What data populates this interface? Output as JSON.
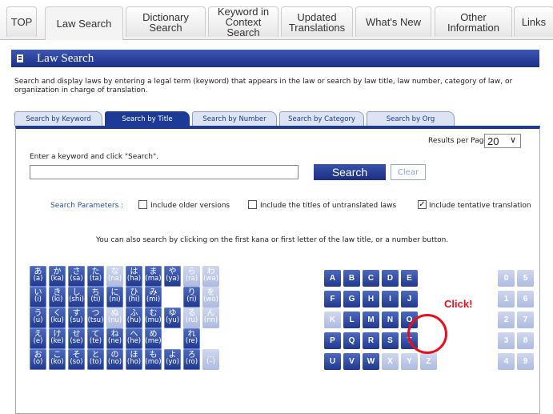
{
  "topnav": {
    "tabs": [
      "TOP",
      "Law Search",
      "Dictionary\nSearch",
      "Keyword in\nContext Search",
      "Updated\nTranslations",
      "What's New",
      "Other\nInformation",
      "Links"
    ]
  },
  "header": {
    "title": "Law Search"
  },
  "description": "Search and display laws by entering a legal term (keyword) that appears in the law or search by law title, law number, category of law, or organization in charge of translation.",
  "search_tabs": [
    "Search by Keyword",
    "Search by Title",
    "Search by Number",
    "Search by Category",
    "Search by Org"
  ],
  "results_per_page": {
    "label": "Results per Page :",
    "value": "20"
  },
  "keyword": {
    "instruction": "Enter a keyword and click \"Search\".",
    "value": "",
    "search_label": "Search",
    "clear_label": "Clear"
  },
  "params": {
    "label": "Search Parameters :",
    "older": "Include older versions",
    "untranslated": "Include the titles of untranslated laws",
    "tentative": "Include tentative translation",
    "tentative_checked": true
  },
  "hint": "You can also search by clicking on the first kana or first letter of the law title, or a number button.",
  "kana": [
    [
      [
        "あ",
        "(a)",
        1
      ],
      [
        "か",
        "(ka)",
        1
      ],
      [
        "さ",
        "(sa)",
        1
      ],
      [
        "た",
        "(ta)",
        1
      ],
      [
        "な",
        "(na)",
        0
      ],
      [
        "は",
        "(ha)",
        1
      ],
      [
        "ま",
        "(ma)",
        1
      ],
      [
        "や",
        "(ya)",
        1
      ],
      [
        "ら",
        "(ra)",
        0
      ],
      [
        "わ",
        "(wa)",
        0
      ]
    ],
    [
      [
        "い",
        "(i)",
        1
      ],
      [
        "き",
        "(ki)",
        1
      ],
      [
        "し",
        "(shi)",
        1
      ],
      [
        "ち",
        "(ti)",
        1
      ],
      [
        "に",
        "(ni)",
        1
      ],
      [
        "ひ",
        "(hi)",
        1
      ],
      [
        "み",
        "(mi)",
        1
      ],
      [
        "",
        ""
      ],
      [
        "り",
        "(ri)",
        1
      ],
      [
        "を",
        "(wo)",
        0
      ]
    ],
    [
      [
        "う",
        "(u)",
        1
      ],
      [
        "く",
        "(ku)",
        1
      ],
      [
        "す",
        "(su)",
        1
      ],
      [
        "つ",
        "(tsu)",
        1
      ],
      [
        "ぬ",
        "(nu)",
        0
      ],
      [
        "ふ",
        "(hu)",
        1
      ],
      [
        "む",
        "(mu)",
        1
      ],
      [
        "ゆ",
        "(yu)",
        1
      ],
      [
        "る",
        "(ru)",
        0
      ],
      [
        "ん",
        "(nn)",
        0
      ]
    ],
    [
      [
        "え",
        "(e)",
        1
      ],
      [
        "け",
        "(ke)",
        1
      ],
      [
        "せ",
        "(se)",
        1
      ],
      [
        "て",
        "(te)",
        1
      ],
      [
        "ね",
        "(ne)",
        1
      ],
      [
        "へ",
        "(he)",
        1
      ],
      [
        "め",
        "(me)",
        1
      ],
      [
        "",
        ""
      ],
      [
        "れ",
        "(re)",
        1
      ],
      [
        "",
        ""
      ]
    ],
    [
      [
        "お",
        "(o)",
        1
      ],
      [
        "こ",
        "(ko)",
        1
      ],
      [
        "そ",
        "(so)",
        1
      ],
      [
        "と",
        "(to)",
        1
      ],
      [
        "の",
        "(no)",
        1
      ],
      [
        "ほ",
        "(ho)",
        1
      ],
      [
        "も",
        "(mo)",
        1
      ],
      [
        "よ",
        "(yo)",
        1
      ],
      [
        "ろ",
        "(ro)",
        1
      ],
      [
        "…",
        "(–)",
        0
      ]
    ]
  ],
  "letters": [
    [
      [
        "A",
        1
      ],
      [
        "B",
        1
      ],
      [
        "C",
        1
      ],
      [
        "D",
        1
      ],
      [
        "E",
        1
      ]
    ],
    [
      [
        "F",
        1
      ],
      [
        "G",
        1
      ],
      [
        "H",
        1
      ],
      [
        "I",
        1
      ],
      [
        "J",
        1
      ]
    ],
    [
      [
        "K",
        0
      ],
      [
        "L",
        1
      ],
      [
        "M",
        1
      ],
      [
        "N",
        1
      ],
      [
        "O",
        1
      ]
    ],
    [
      [
        "P",
        1
      ],
      [
        "Q",
        1
      ],
      [
        "R",
        1
      ],
      [
        "S",
        1
      ],
      [
        "T",
        1
      ]
    ],
    [
      [
        "U",
        1
      ],
      [
        "V",
        1
      ],
      [
        "W",
        1
      ],
      [
        "X",
        0
      ],
      [
        "Y",
        0
      ],
      [
        "Z",
        0
      ]
    ]
  ],
  "numbers": [
    [
      "0",
      "5"
    ],
    [
      "1",
      "6"
    ],
    [
      "2",
      "7"
    ],
    [
      "3",
      "8"
    ],
    [
      "4",
      "9"
    ]
  ],
  "annotation": {
    "text": "Click!"
  },
  "colors": {
    "navy": "#1e3a97",
    "annotation_red": "#e8101b"
  }
}
